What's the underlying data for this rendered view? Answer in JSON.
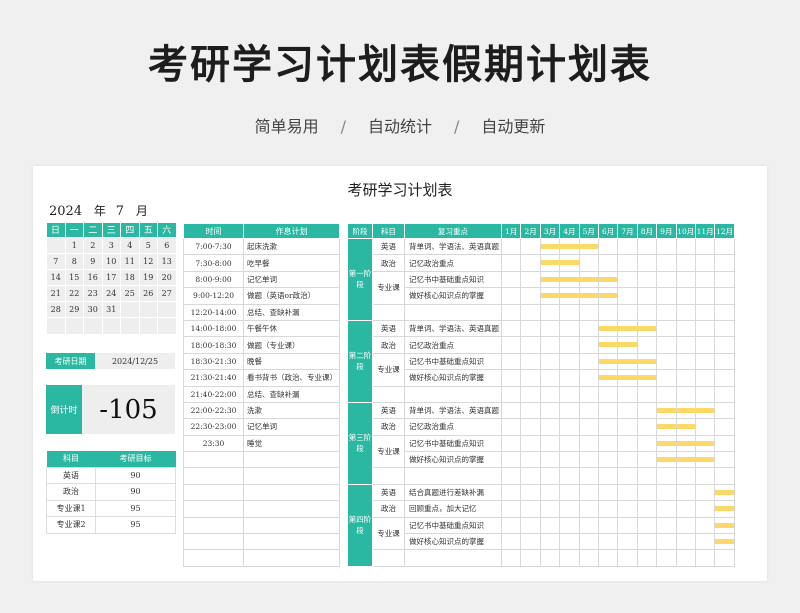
{
  "header": {
    "title": "考研学习计划表假期计划表",
    "sub": [
      "简单易用",
      "自动统计",
      "自动更新"
    ],
    "sep": "/"
  },
  "sheet": {
    "title": "考研学习计划表",
    "year": "2024",
    "year_unit": "年",
    "month": "7",
    "month_unit": "月"
  },
  "calendar": {
    "weekdays": [
      "日",
      "一",
      "二",
      "三",
      "四",
      "五",
      "六"
    ],
    "weeks": [
      [
        "",
        "1",
        "2",
        "3",
        "4",
        "5",
        "6"
      ],
      [
        "7",
        "8",
        "9",
        "10",
        "11",
        "12",
        "13"
      ],
      [
        "14",
        "15",
        "16",
        "17",
        "18",
        "19",
        "20"
      ],
      [
        "21",
        "22",
        "23",
        "24",
        "25",
        "26",
        "27"
      ],
      [
        "28",
        "29",
        "30",
        "31",
        "",
        "",
        ""
      ],
      [
        "",
        "",
        "",
        "",
        "",
        "",
        ""
      ]
    ]
  },
  "countdown": {
    "date_label": "考研日期",
    "date": "2024/12/25",
    "label": "倒计时",
    "value": "-105"
  },
  "targets": {
    "headers": [
      "科目",
      "考研目标"
    ],
    "rows": [
      [
        "英语",
        "90"
      ],
      [
        "政治",
        "90"
      ],
      [
        "专业课1",
        "95"
      ],
      [
        "专业课2",
        "95"
      ]
    ]
  },
  "schedule": {
    "headers": [
      "时间",
      "作息计划"
    ],
    "rows": [
      [
        "7:00-7:30",
        "起床洗漱"
      ],
      [
        "7:30-8:00",
        "吃早餐"
      ],
      [
        "8:00-9:00",
        "记忆单词"
      ],
      [
        "9:00-12:20",
        "做题（英语or政治）"
      ],
      [
        "12:20-14:00",
        "总结、查缺补漏"
      ],
      [
        "14:00-18:00",
        "午餐午休"
      ],
      [
        "18:00-18:30",
        "做题（专业课）"
      ],
      [
        "18:30-21:30",
        "晚餐"
      ],
      [
        "21:30-21:40",
        "看书背书（政治、专业课）"
      ],
      [
        "21:40-22:00",
        "总结、查缺补漏"
      ],
      [
        "22:00-22:30",
        "洗漱"
      ],
      [
        "22:30-23:00",
        "记忆单词"
      ],
      [
        "23:30",
        "睡觉"
      ],
      [
        "",
        ""
      ],
      [
        "",
        ""
      ],
      [
        "",
        ""
      ],
      [
        "",
        ""
      ],
      [
        "",
        ""
      ],
      [
        "",
        ""
      ],
      [
        "",
        ""
      ]
    ]
  },
  "plan": {
    "headers": [
      "阶段",
      "科目",
      "复习重点"
    ],
    "months": [
      "1月",
      "2月",
      "3月",
      "4月",
      "5月",
      "6月",
      "7月",
      "8月",
      "9月",
      "10月",
      "11月",
      "12月"
    ],
    "stages": [
      {
        "name": "第一阶段",
        "rows": [
          {
            "subject": "英语",
            "key": "背单词、学语法、英语真题",
            "start": 3,
            "end": 5
          },
          {
            "subject": "政治",
            "key": "记忆政治重点",
            "start": 3,
            "end": 4
          },
          {
            "subject": "专业课",
            "key": "记忆书中基础重点知识",
            "start": 3,
            "end": 6
          },
          {
            "subject": "",
            "key": "做好核心知识点的掌握",
            "start": 3,
            "end": 6
          }
        ]
      },
      {
        "name": "第二阶段",
        "rows": [
          {
            "subject": "英语",
            "key": "背单词、学语法、英语真题",
            "start": 6,
            "end": 8
          },
          {
            "subject": "政治",
            "key": "记忆政治重点",
            "start": 6,
            "end": 7
          },
          {
            "subject": "专业课",
            "key": "记忆书中基础重点知识",
            "start": 6,
            "end": 8
          },
          {
            "subject": "",
            "key": "做好核心知识点的掌握",
            "start": 6,
            "end": 8
          }
        ]
      },
      {
        "name": "第三阶段",
        "rows": [
          {
            "subject": "英语",
            "key": "背单词、学语法、英语真题",
            "start": 9,
            "end": 11
          },
          {
            "subject": "政治",
            "key": "记忆政治重点",
            "start": 9,
            "end": 10
          },
          {
            "subject": "专业课",
            "key": "记忆书中基础重点知识",
            "start": 9,
            "end": 11
          },
          {
            "subject": "",
            "key": "做好核心知识点的掌握",
            "start": 9,
            "end": 11
          }
        ]
      },
      {
        "name": "第四阶段",
        "rows": [
          {
            "subject": "英语",
            "key": "结合真题进行差缺补漏",
            "start": 12,
            "end": 12
          },
          {
            "subject": "政治",
            "key": "回顾重点，加大记忆",
            "start": 12,
            "end": 12
          },
          {
            "subject": "专业课",
            "key": "记忆书中基础重点知识",
            "start": 12,
            "end": 12
          },
          {
            "subject": "",
            "key": "做好核心知识点的掌握",
            "start": 12,
            "end": 12
          }
        ]
      }
    ]
  },
  "colors": {
    "accent": "#2bb8a3",
    "bar": "#fcd866"
  }
}
